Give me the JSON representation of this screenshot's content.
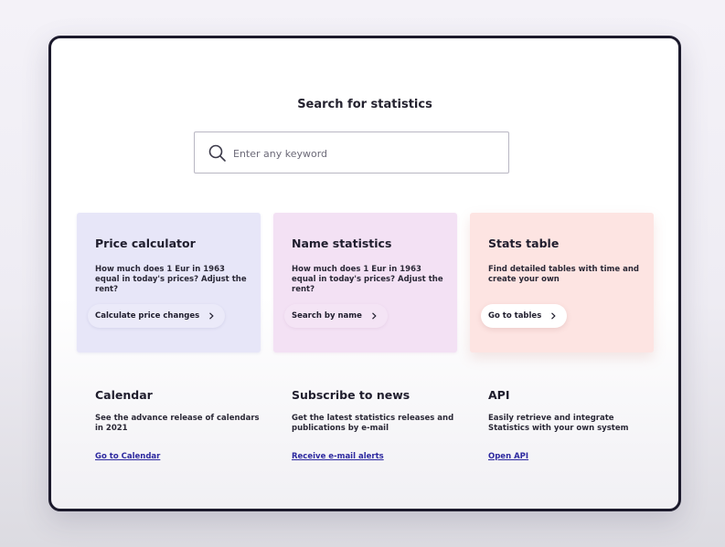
{
  "hero": {
    "title": "Search for statistics",
    "search_placeholder": "Enter any keyword",
    "search_value": ""
  },
  "cards": [
    {
      "title": "Price calculator",
      "description": "How much does 1 Eur in 1963 equal in today's prices? Adjust the rent?",
      "button": "Calculate price changes",
      "color": "#e7e6f8"
    },
    {
      "title": "Name statistics",
      "description": "How much does 1 Eur in 1963 equal in today's prices? Adjust the rent?",
      "button": "Search by name",
      "color": "#f3e1f4"
    },
    {
      "title": "Stats table",
      "description": "Find detailed tables with time and create your own",
      "button": "Go to tables",
      "color": "#fde4e2"
    }
  ],
  "info": [
    {
      "title": "Calendar",
      "description": "See the advance release of calendars in 2021",
      "link": "Go to Calendar"
    },
    {
      "title": "Subscribe to news",
      "description": "Get the latest statistics releases and publications by e-mail",
      "link": "Receive e-mail alerts"
    },
    {
      "title": "API",
      "description": "Easily retrieve and integrate Statistics with your own system",
      "link": "Open API"
    }
  ],
  "colors": {
    "link": "#2e2aa0",
    "frame_border": "#1c1a2c"
  },
  "icons": {
    "search": "search-icon",
    "chevron": "chevron-right-icon"
  }
}
